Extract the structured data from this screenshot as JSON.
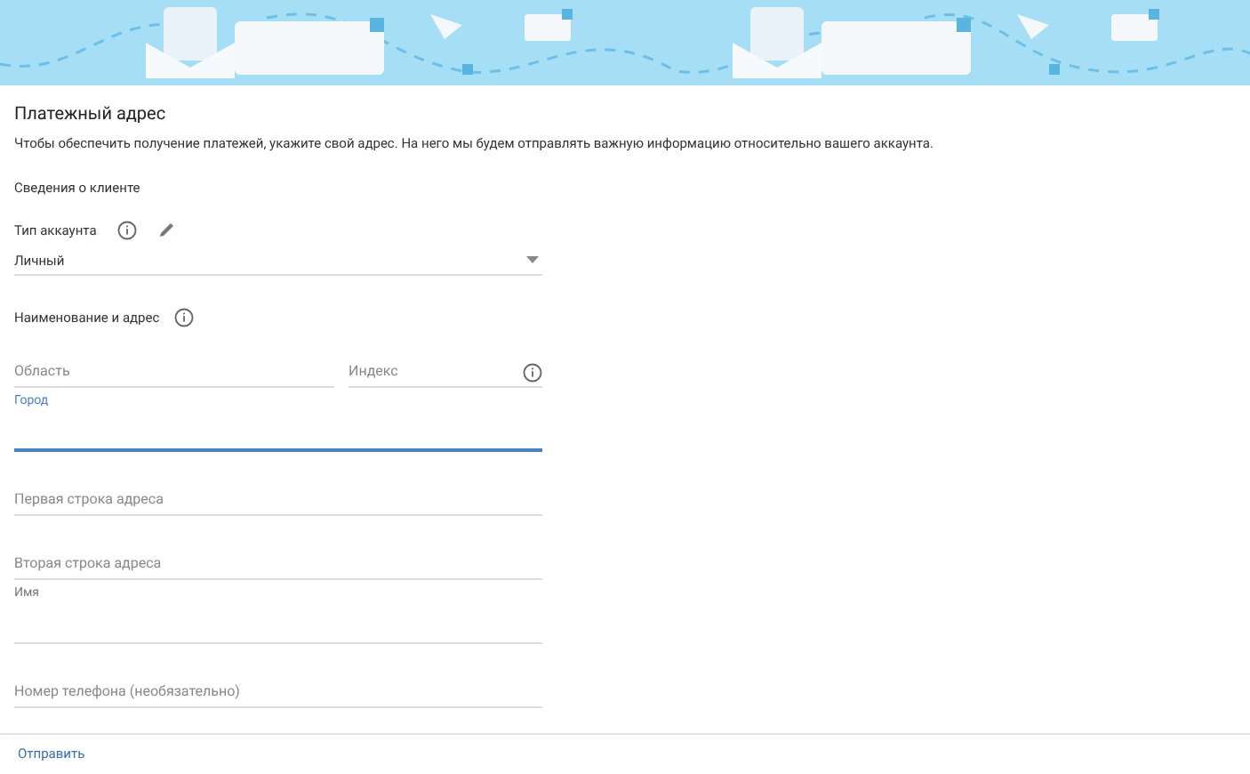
{
  "title": "Платежный адрес",
  "description": "Чтобы обеспечить получение платежей, укажите свой адрес. На него мы будем отправлять важную информацию относительно вашего аккаунта.",
  "section": "Сведения о клиенте",
  "account_type": {
    "label": "Тип аккаунта",
    "value": "Личный"
  },
  "name_address": {
    "label": "Наименование и адрес"
  },
  "region_row": [
    {
      "label": "Область",
      "floated": false,
      "focused": false,
      "info": false
    },
    {
      "label": "Индекс",
      "floated": false,
      "focused": false,
      "info": true
    }
  ],
  "fields": [
    {
      "label": "Город",
      "floated": true,
      "focused": true
    },
    {
      "label": "Первая строка адреса",
      "floated": false,
      "focused": false
    },
    {
      "label": "Вторая строка адреса",
      "floated": false,
      "focused": false
    },
    {
      "label": "Имя",
      "floated": true,
      "focused": false
    },
    {
      "label": "Номер телефона (необязательно)",
      "floated": false,
      "focused": false
    }
  ],
  "submit": "Отправить"
}
